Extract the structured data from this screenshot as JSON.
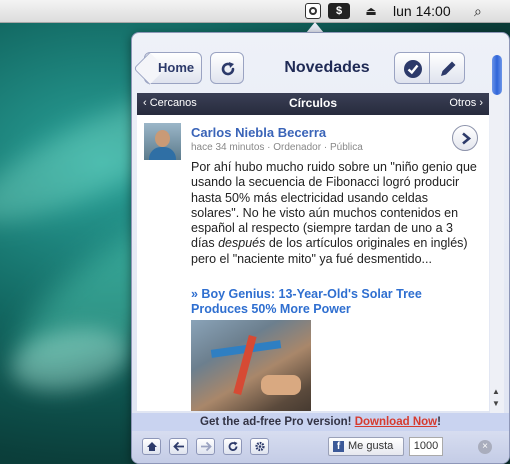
{
  "menubar": {
    "clock": "lun 14:00",
    "app_icon_label": "$",
    "eject_glyph": "⏏",
    "search_glyph": "⌕"
  },
  "header": {
    "home_label": "Home",
    "title": "Novedades"
  },
  "nav": {
    "left": "‹ Cercanos",
    "center": "Círculos",
    "right": "Otros ›"
  },
  "post": {
    "author": "Carlos Niebla Becerra",
    "meta": "hace 34 minutos · Ordenador · Pública",
    "body_before": "Por ahí hubo mucho ruido sobre un \"niño genio que usando la secuencia de Fibonacci logró producir hasta 50% más electricidad usando celdas solares\". No he visto aún muchos contenidos en español al respecto (siempre tardan de uno a 3 días ",
    "body_emph": "después",
    "body_after": " de los artículos originales en inglés) pero el \"naciente mito\" ya fué desmentido...",
    "link_title": "» Boy Genius: 13-Year-Old's Solar Tree Produces 50% More Power"
  },
  "promo": {
    "text": "Get the ad-free Pro version! ",
    "link": "Download Now",
    "end": "!"
  },
  "footer": {
    "like_label": "Me gusta",
    "fb_glyph": "f",
    "like_count": "1000",
    "close_glyph": "×"
  },
  "colors": {
    "accent": "#3a64b8",
    "link": "#2f6fd0",
    "promo_link": "#d63b2f",
    "navbar": "#2f3347"
  }
}
